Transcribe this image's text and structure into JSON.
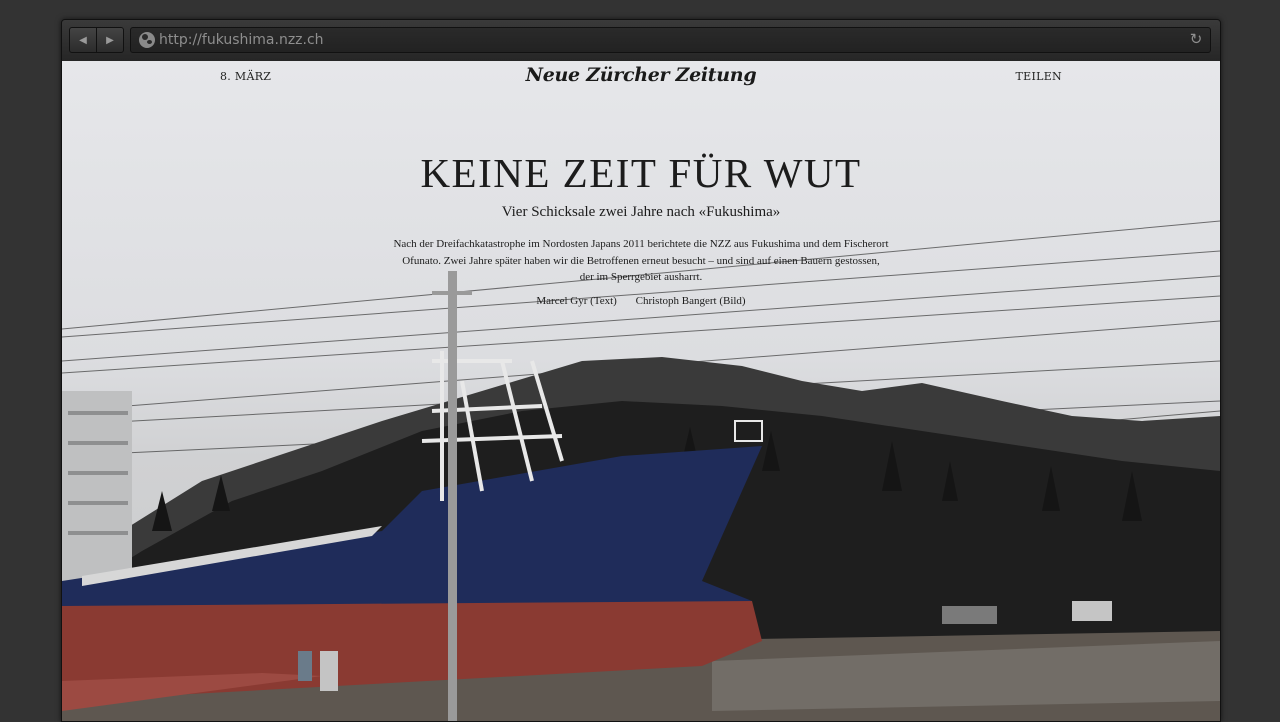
{
  "browser": {
    "url": "http://fukushima.nzz.ch",
    "back_icon": "◀",
    "forward_icon": "▶",
    "reload_icon": "↻"
  },
  "header": {
    "date": "8. MÄRZ",
    "logo": "Neue Zürcher Zeitung",
    "share": "TEILEN"
  },
  "article": {
    "title": "KEINE ZEIT FÜR WUT",
    "subtitle": "Vier Schicksale zwei Jahre nach «Fukushima»",
    "intro_lines": [
      "Nach der Dreifachkatastrophe im Nordosten Japans 2011 berichtete die NZZ aus Fukushima und dem Fischerort",
      "Ofunato. Zwei Jahre später haben wir die Betroffenen erneut besucht – und sind auf einen Bauern gestossen,",
      "der im Sperrgebiet ausharrt."
    ],
    "author_text": "Marcel Gyr (Text)",
    "author_image": "Christoph Bangert (Bild)"
  },
  "colors": {
    "sky": "#e3e4e6",
    "hill": "#2a2a2a",
    "hull_blue": "#1f2c5a",
    "hull_red": "#8a3a32"
  }
}
